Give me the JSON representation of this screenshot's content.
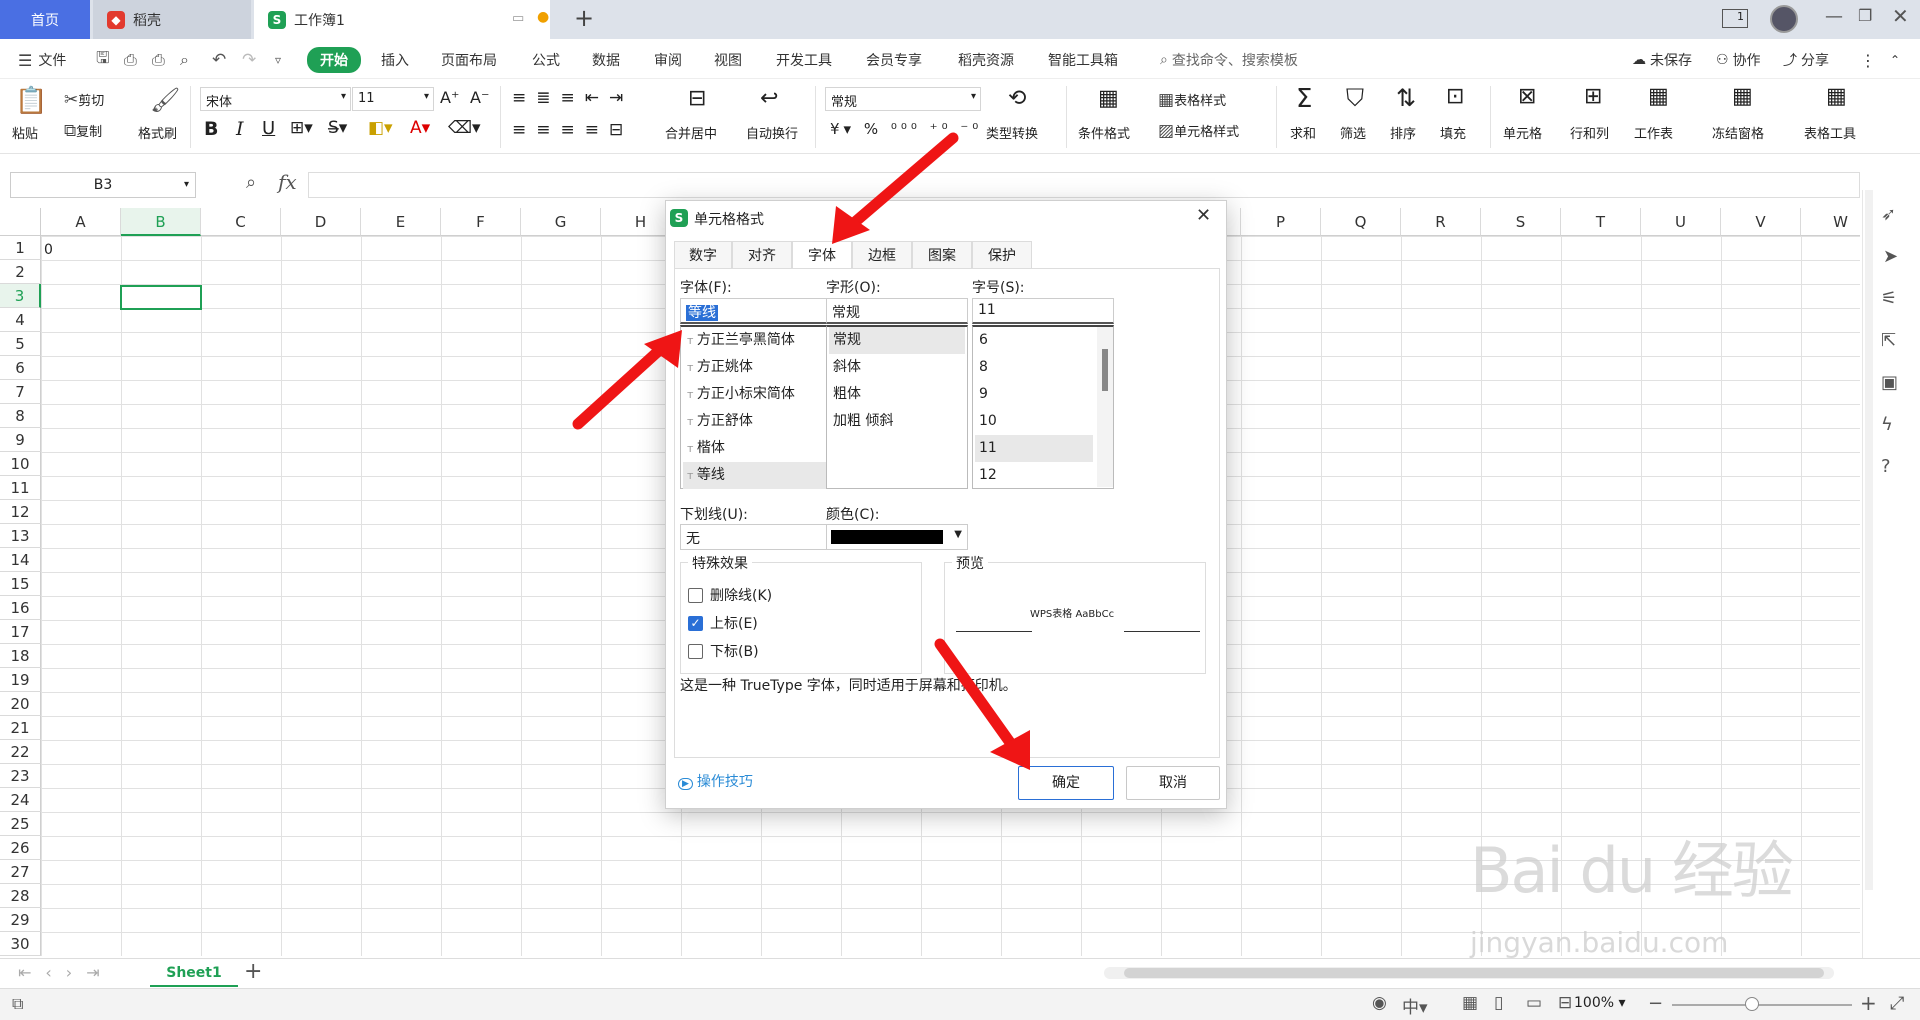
{
  "titlebar": {
    "home_tab": "首页",
    "tab_daoke": "稻壳",
    "tab_workbook": "工作簿1",
    "new_tab": "+",
    "page_badge": "1"
  },
  "menu": {
    "file": "文件",
    "items": [
      "开始",
      "插入",
      "页面布局",
      "公式",
      "数据",
      "审阅",
      "视图",
      "开发工具",
      "会员专享",
      "稻壳资源",
      "智能工具箱"
    ],
    "search_placeholder": "查找命令、搜索模板",
    "unsaved": "未保存",
    "collab": "协作",
    "share": "分享"
  },
  "ribbon": {
    "paste": "粘贴",
    "cut": "剪切",
    "copy": "复制",
    "format_painter": "格式刷",
    "font_name": "宋体",
    "font_size": "11",
    "merge_center": "合并居中",
    "wrap_text": "自动换行",
    "number_format": "常规",
    "type_convert": "类型转换",
    "cond_format": "条件格式",
    "table_style": "表格样式",
    "cell_style": "单元格样式",
    "sum": "求和",
    "filter": "筛选",
    "sort": "排序",
    "fill": "填充",
    "cell": "单元格",
    "row_col": "行和列",
    "worksheet": "工作表",
    "freeze": "冻结窗格",
    "table_tools": "表格工具"
  },
  "formula_bar": {
    "name_box": "B3",
    "fx": "fx",
    "formula": ""
  },
  "grid": {
    "columns": [
      "A",
      "B",
      "C",
      "D",
      "E",
      "F",
      "G",
      "H",
      "",
      "",
      "",
      "",
      "",
      "",
      "",
      "P",
      "Q",
      "R",
      "S",
      "T",
      "U",
      "V",
      "W"
    ],
    "rows": [
      "1",
      "2",
      "3",
      "4",
      "5",
      "6",
      "7",
      "8",
      "9",
      "10",
      "11",
      "12",
      "13",
      "14",
      "15",
      "16",
      "17",
      "18",
      "19",
      "20",
      "21",
      "22",
      "23",
      "24",
      "25",
      "26",
      "27",
      "28",
      "29",
      "30"
    ],
    "cell_a1": "0"
  },
  "sheetbar": {
    "sheet_name": "Sheet1",
    "add": "+"
  },
  "statusbar": {
    "zoom": "100%"
  },
  "dialog": {
    "title": "单元格格式",
    "tabs": [
      "数字",
      "对齐",
      "字体",
      "边框",
      "图案",
      "保护"
    ],
    "active_tab": "字体",
    "font_label": "字体(F):",
    "font_value": "等线",
    "font_list": [
      "方正兰亭黑简体",
      "方正姚体",
      "方正小标宋简体",
      "方正舒体",
      "楷体",
      "等线"
    ],
    "style_label": "字形(O):",
    "style_value": "常规",
    "style_list": [
      "常规",
      "斜体",
      "粗体",
      "加粗 倾斜"
    ],
    "size_label": "字号(S):",
    "size_value": "11",
    "size_list": [
      "6",
      "8",
      "9",
      "10",
      "11",
      "12"
    ],
    "underline_label": "下划线(U):",
    "underline_value": "无",
    "color_label": "颜色(C):",
    "color_value": "#000000",
    "effects_label": "特殊效果",
    "strikethrough": "删除线(K)",
    "superscript": "上标(E)",
    "subscript": "下标(B)",
    "superscript_checked": true,
    "preview_label": "预览",
    "preview_text": "WPS表格 AaBbCc",
    "note": "这是一种 TrueType 字体，同时适用于屏幕和打印机。",
    "tips": "操作技巧",
    "ok": "确定",
    "cancel": "取消"
  },
  "watermark": {
    "brand": "Bai du 经验",
    "url": "jingyan.baidu.com"
  },
  "colors": {
    "accent_green": "#1fa055",
    "home_blue": "#4a6fe3",
    "arrow_red": "#ef1515"
  }
}
